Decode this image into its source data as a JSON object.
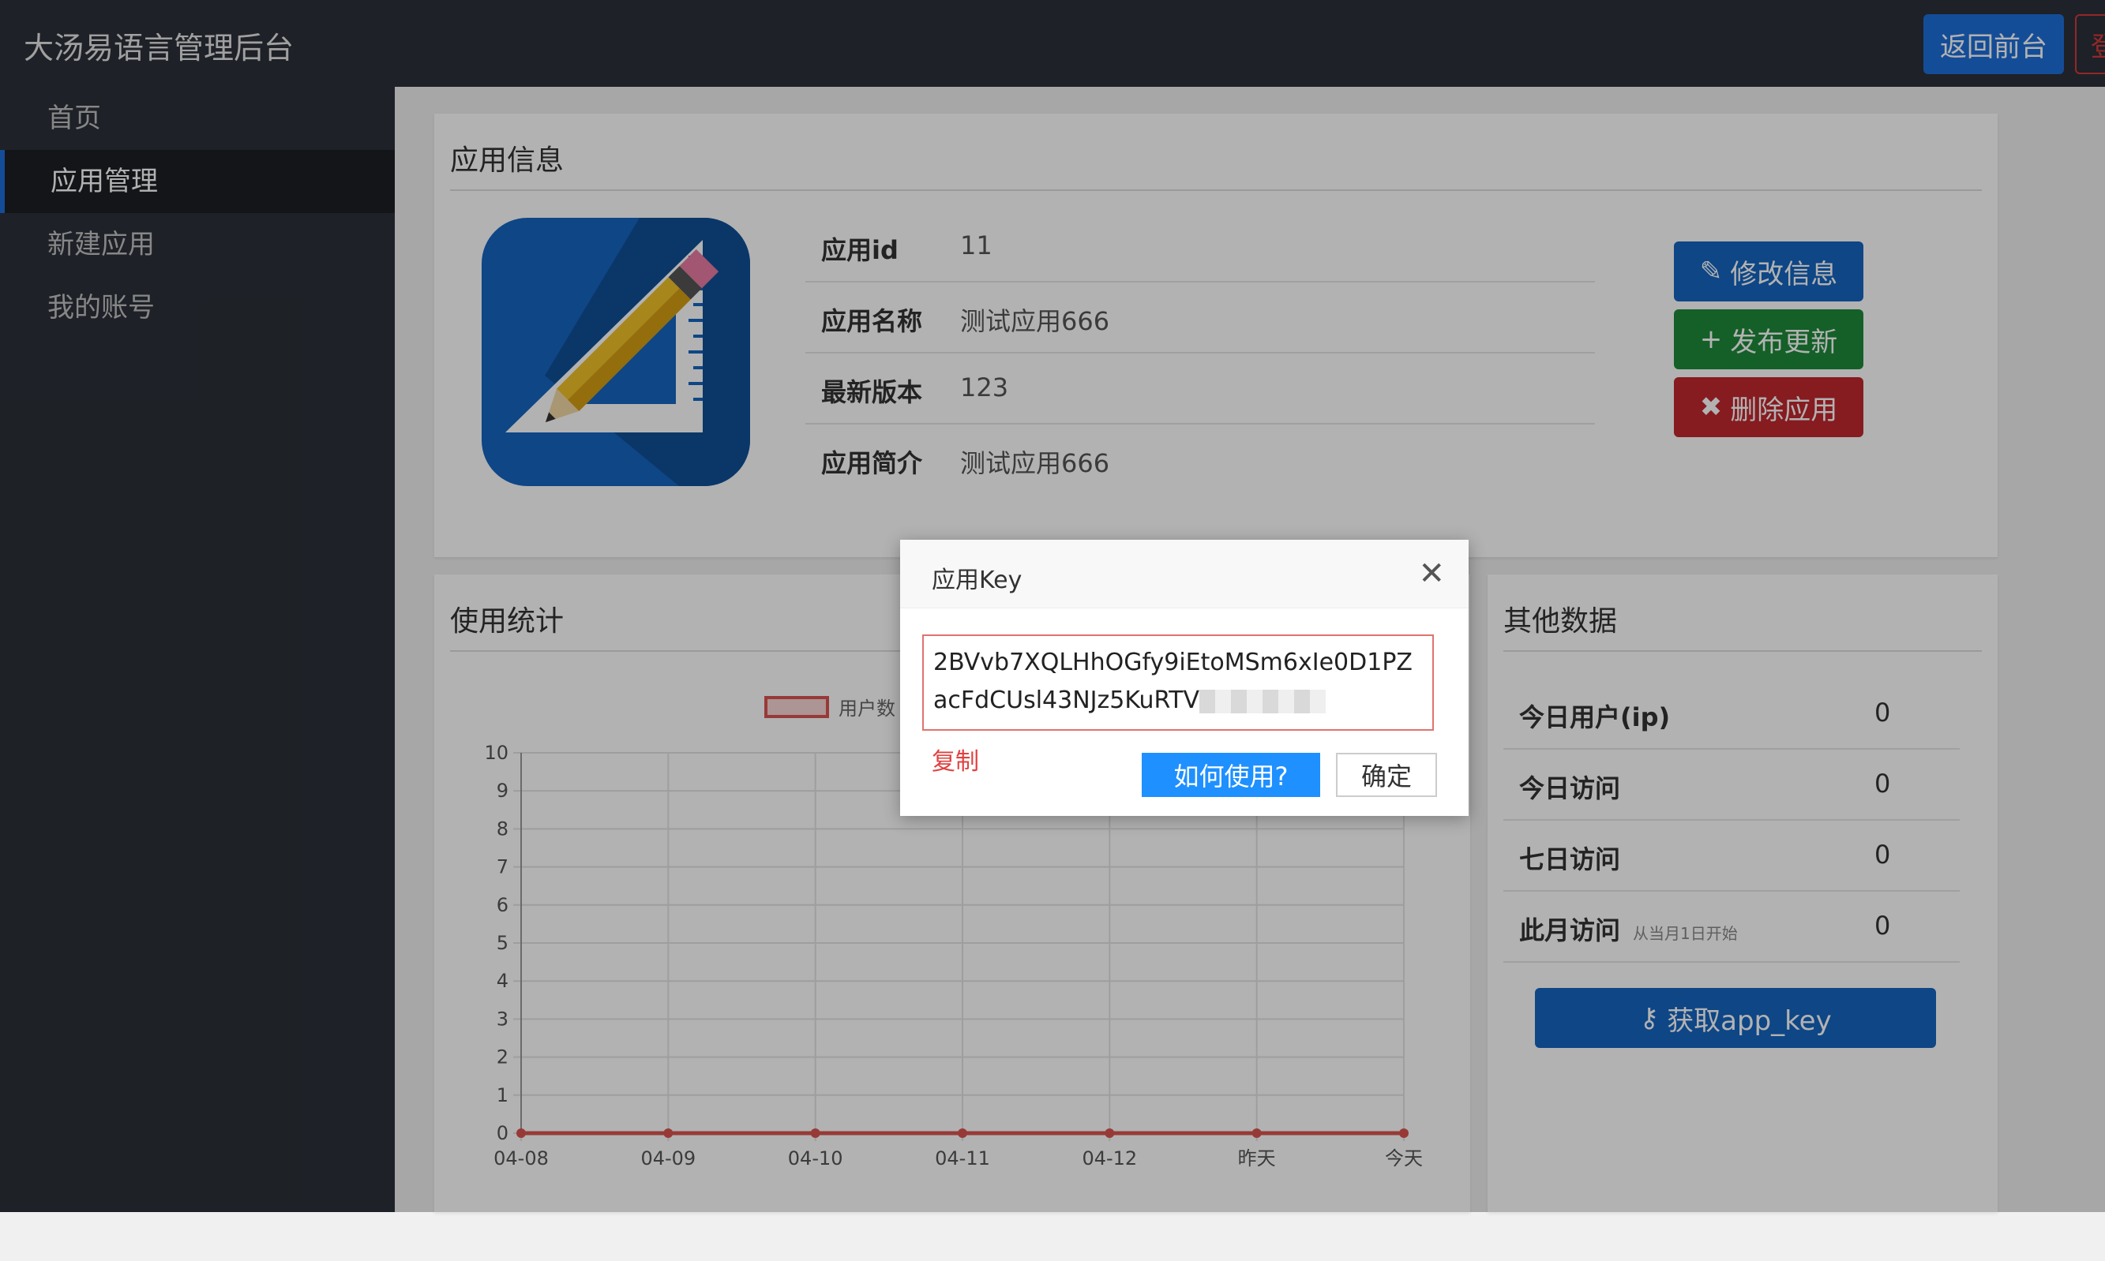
{
  "header": {
    "brand": "大汤易语言管理后台",
    "back_button": "返回前台",
    "logout_button": "登"
  },
  "sidebar": {
    "items": [
      {
        "label": "首页",
        "active": false
      },
      {
        "label": "应用管理",
        "active": true
      },
      {
        "label": "新建应用",
        "active": false
      },
      {
        "label": "我的账号",
        "active": false
      }
    ]
  },
  "app_info": {
    "title": "应用信息",
    "rows": [
      {
        "label": "应用id",
        "value": "11"
      },
      {
        "label": "应用名称",
        "value": "测试应用666"
      },
      {
        "label": "最新版本",
        "value": "123"
      },
      {
        "label": "应用简介",
        "value": "测试应用666"
      }
    ],
    "actions": {
      "edit": "修改信息",
      "publish": "发布更新",
      "delete": "删除应用"
    }
  },
  "usage": {
    "title": "使用统计"
  },
  "other": {
    "title": "其他数据",
    "rows": [
      {
        "label": "今日用户(ip)",
        "note": "",
        "value": "0"
      },
      {
        "label": "今日访问",
        "note": "",
        "value": "0"
      },
      {
        "label": "七日访问",
        "note": "",
        "value": "0"
      },
      {
        "label": "此月访问",
        "note": "从当月1日开始",
        "value": "0"
      }
    ],
    "get_key_button": "获取app_key"
  },
  "modal": {
    "title": "应用Key",
    "key_text": "2BVvb7XQLHhOGfy9iEtoMSm6xIe0D1PZacFdCUsl43NJz5KuRTV",
    "copy_link": "复制",
    "how_button": "如何使用?",
    "ok_button": "确定"
  },
  "colors": {
    "topbar": "#2b3038",
    "primary": "#1565c0",
    "success": "#1e8a3a",
    "danger": "#c0282e",
    "series": "#d9534f"
  },
  "chart_data": {
    "type": "line",
    "categories": [
      "04-08",
      "04-09",
      "04-10",
      "04-11",
      "04-12",
      "昨天",
      "今天"
    ],
    "series": [
      {
        "name": "用户数",
        "values": [
          0,
          0,
          0,
          0,
          0,
          0,
          0
        ]
      }
    ],
    "ylim": [
      0,
      10
    ],
    "yticks": [
      0,
      1,
      2,
      3,
      4,
      5,
      6,
      7,
      8,
      9,
      10
    ],
    "grid": true,
    "legend": "top-center"
  }
}
